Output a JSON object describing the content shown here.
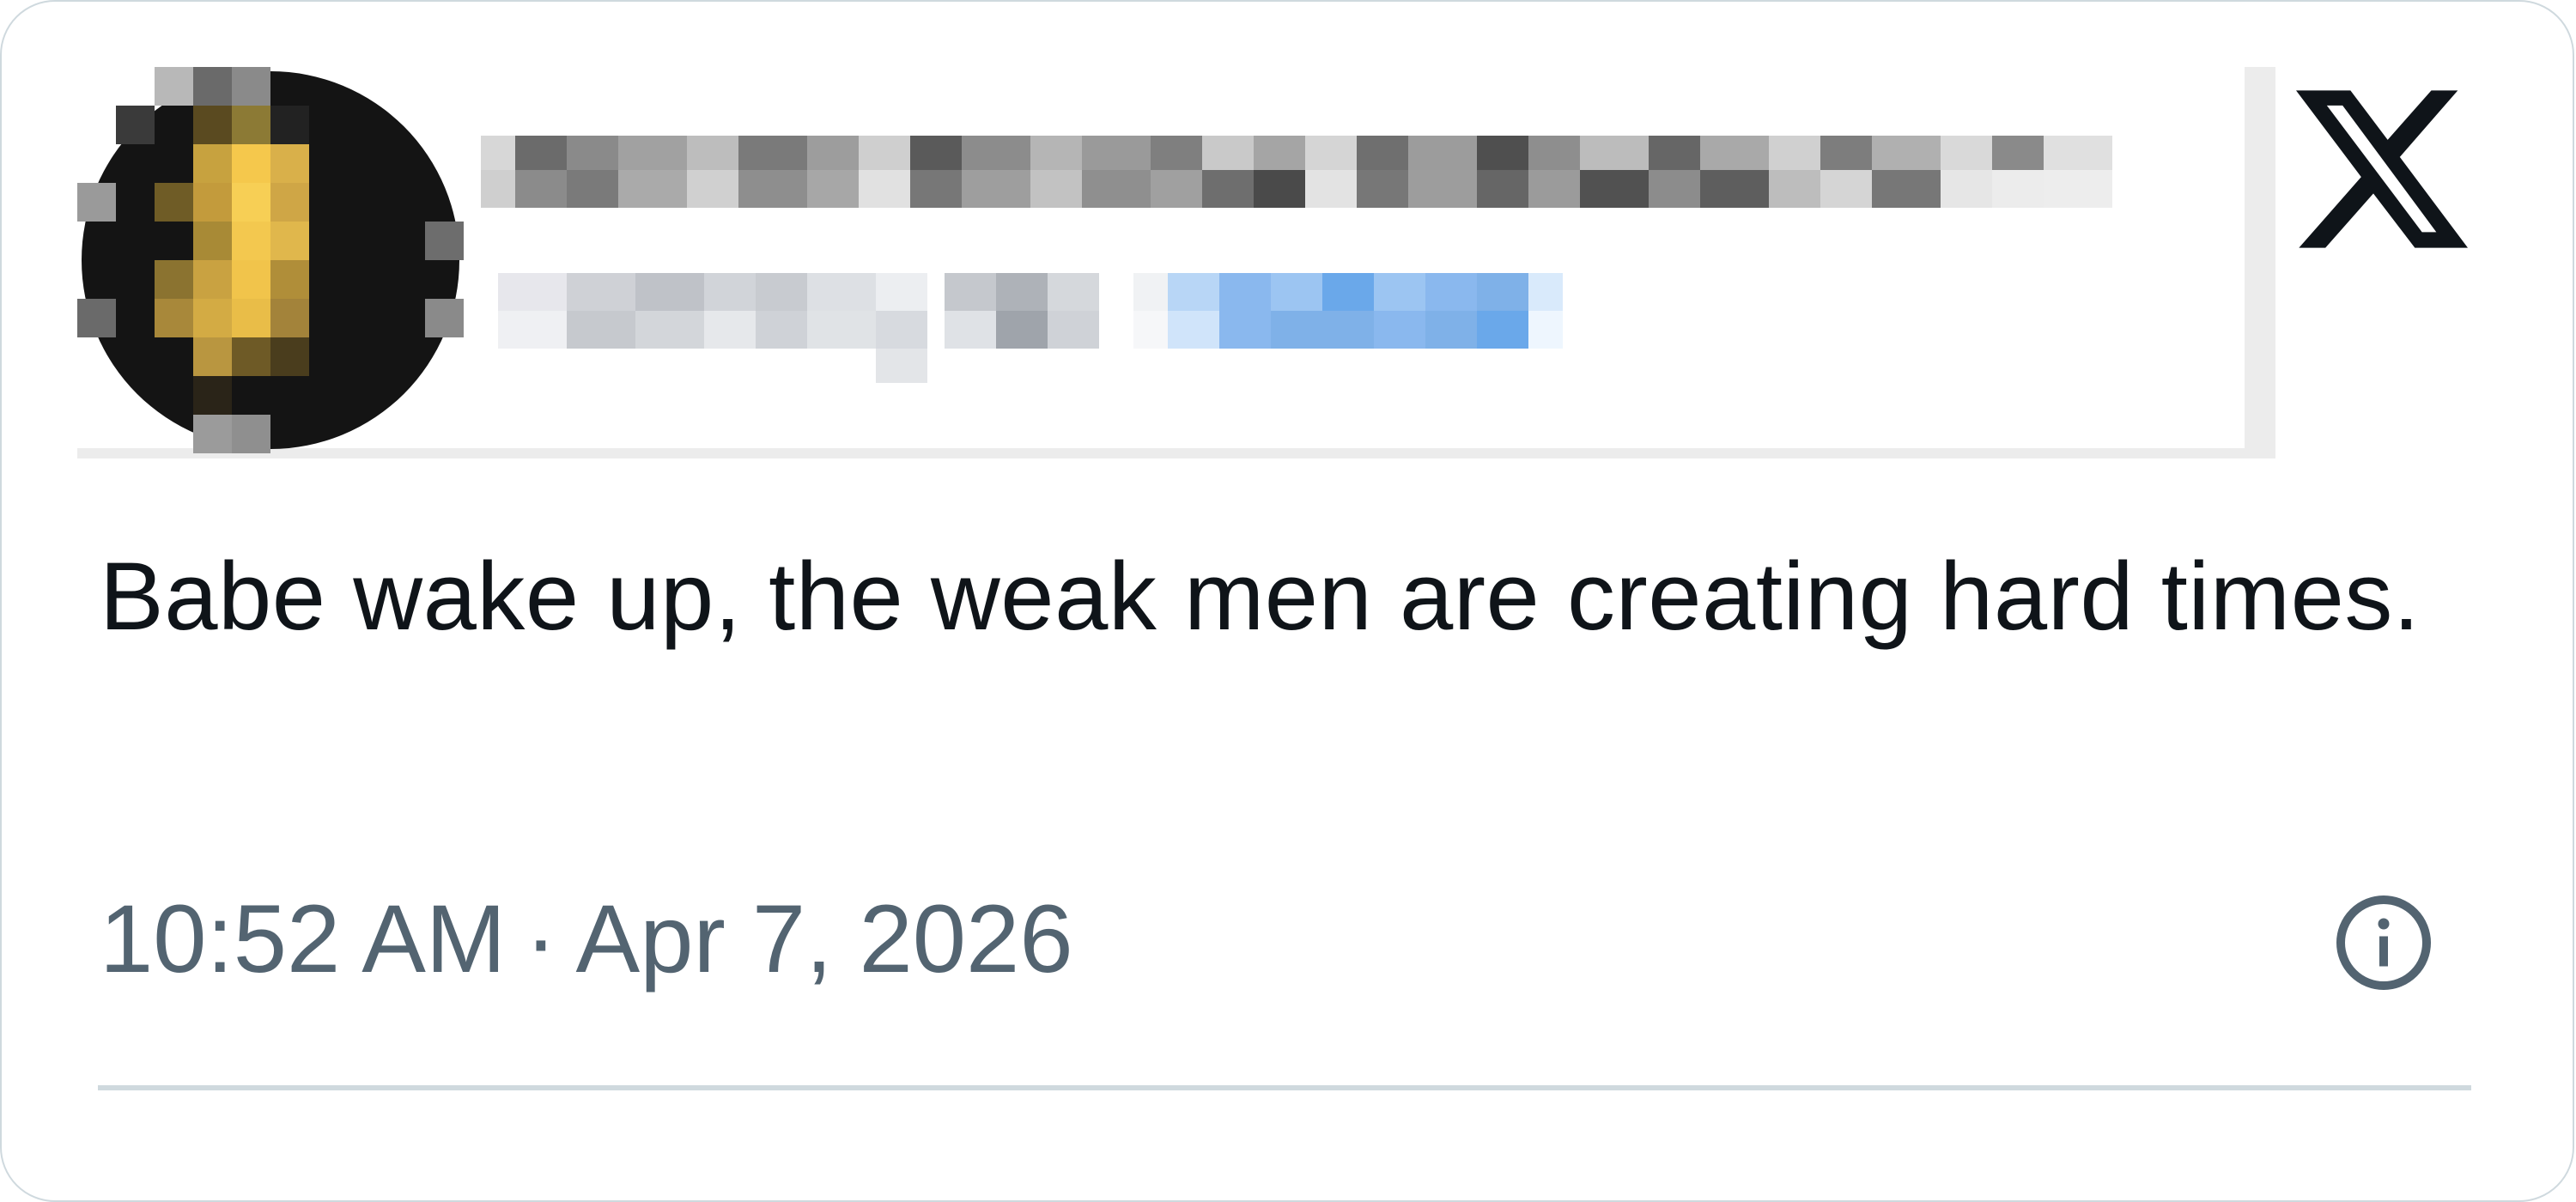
{
  "tweet": {
    "text": "Babe wake up, the weak men are creating hard times.",
    "time": "10:52 AM",
    "separator": "·",
    "date": "Apr 7, 2026"
  },
  "icons": {
    "brand": "x-logo-icon",
    "info": "info-icon",
    "avatar": "pixelated-avatar"
  },
  "colors": {
    "text": "#0f1419",
    "meta": "#536471",
    "border": "#cfd9de",
    "link_blur": "#7fb1e8"
  }
}
